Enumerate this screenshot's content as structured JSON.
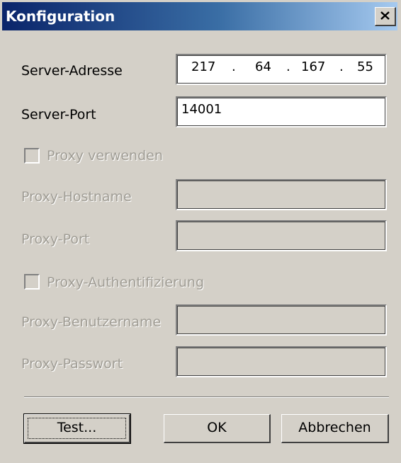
{
  "window": {
    "title": "Konfiguration"
  },
  "titlebar": {
    "close_icon": "close-icon"
  },
  "form": {
    "server_address": {
      "label": "Server-Adresse",
      "octets": [
        "217",
        "64",
        "167",
        "55"
      ],
      "separator": "."
    },
    "server_port": {
      "label": "Server-Port",
      "value": "14001"
    },
    "use_proxy": {
      "label": "Proxy verwenden",
      "checked": false,
      "enabled": false
    },
    "proxy_hostname": {
      "label": "Proxy-Hostname",
      "value": "",
      "enabled": false
    },
    "proxy_port": {
      "label": "Proxy-Port",
      "value": "",
      "enabled": false
    },
    "proxy_auth": {
      "label": "Proxy-Authentifizierung",
      "checked": false,
      "enabled": false
    },
    "proxy_username": {
      "label": "Proxy-Benutzername",
      "value": "",
      "enabled": false
    },
    "proxy_password": {
      "label": "Proxy-Passwort",
      "value": "",
      "enabled": false
    }
  },
  "buttons": {
    "test_label": "Test...",
    "ok_label": "OK",
    "cancel_label": "Abbrechen"
  },
  "colors": {
    "titlebar_start": "#0a246a",
    "titlebar_end": "#a6caf0",
    "dialog_face": "#d4d0c8",
    "disabled_text": "#a09d95"
  }
}
